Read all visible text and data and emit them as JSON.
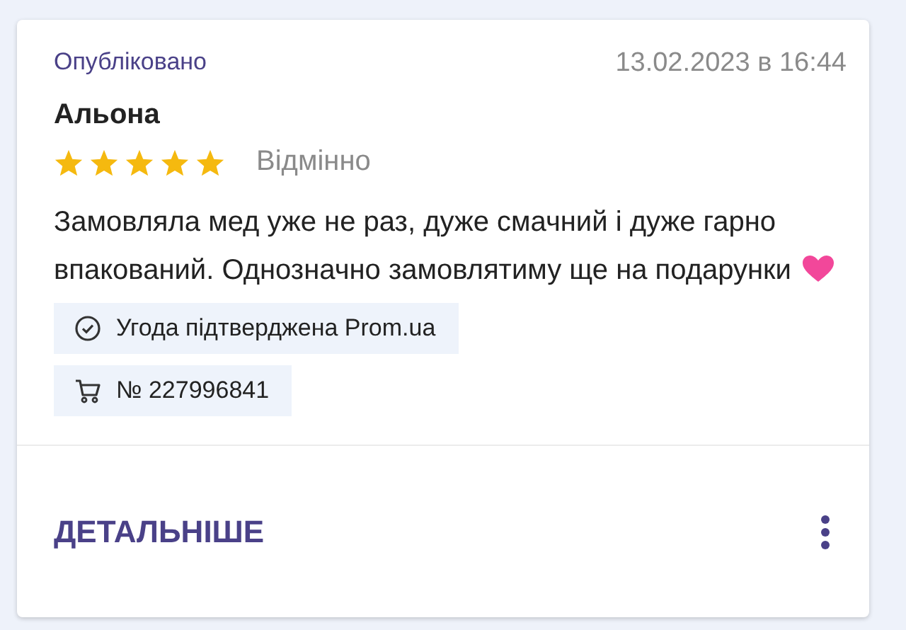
{
  "review": {
    "status": "Опубліковано",
    "date": "13.02.2023 в 16:44",
    "author": "Альона",
    "stars": 5,
    "rating_label": "Відмінно",
    "text": "Замовляла мед уже не раз, дуже смачний і дуже гарно впакований. Однозначно замовлятиму ще на подарунки",
    "badges": [
      {
        "kind": "verified",
        "text": "Угода підтверджена Prom.ua"
      },
      {
        "kind": "order",
        "text": "№ 227996841"
      }
    ]
  },
  "footer": {
    "button": "ДЕТАЛЬНІШЕ"
  }
}
